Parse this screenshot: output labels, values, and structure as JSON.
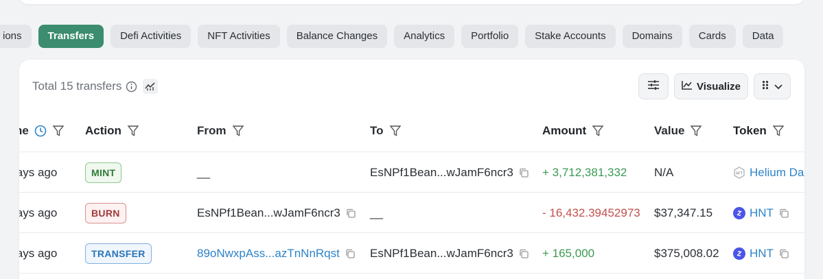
{
  "tabs": [
    {
      "label": "ions",
      "active": false
    },
    {
      "label": "Transfers",
      "active": true
    },
    {
      "label": "Defi Activities",
      "active": false
    },
    {
      "label": "NFT Activities",
      "active": false
    },
    {
      "label": "Balance Changes",
      "active": false
    },
    {
      "label": "Analytics",
      "active": false
    },
    {
      "label": "Portfolio",
      "active": false
    },
    {
      "label": "Stake Accounts",
      "active": false
    },
    {
      "label": "Domains",
      "active": false
    },
    {
      "label": "Cards",
      "active": false
    },
    {
      "label": "Data",
      "active": false
    }
  ],
  "toolbar": {
    "total_label": "Total 15 transfers",
    "visualize_label": "Visualize"
  },
  "columns": {
    "time": "ne",
    "action": "Action",
    "from": "From",
    "to": "To",
    "amount": "Amount",
    "value": "Value",
    "token": "Token"
  },
  "rows": [
    {
      "time": "lays ago",
      "action": "MINT",
      "from": "__",
      "to": "EsNPf1Bean...wJamF6ncr3",
      "amount": "+ 3,712,381,332",
      "value": "N/A",
      "token": "Helium Da"
    },
    {
      "time": "lays ago",
      "action": "BURN",
      "from": "EsNPf1Bean...wJamF6ncr3",
      "to": "__",
      "amount": "- 16,432.39452973",
      "value": "$37,347.15",
      "token": "HNT"
    },
    {
      "time": "lays ago",
      "action": "TRANSFER",
      "from": "89oNwxpAss...azTnNnRqst",
      "to": "EsNPf1Bean...wJamF6ncr3",
      "amount": "+ 165,000",
      "value": "$375,008.02",
      "token": "HNT"
    }
  ],
  "colors": {
    "accent": "#3c8d70",
    "positive": "#3a9a54",
    "negative": "#c0504e",
    "link": "#2d83c9"
  }
}
